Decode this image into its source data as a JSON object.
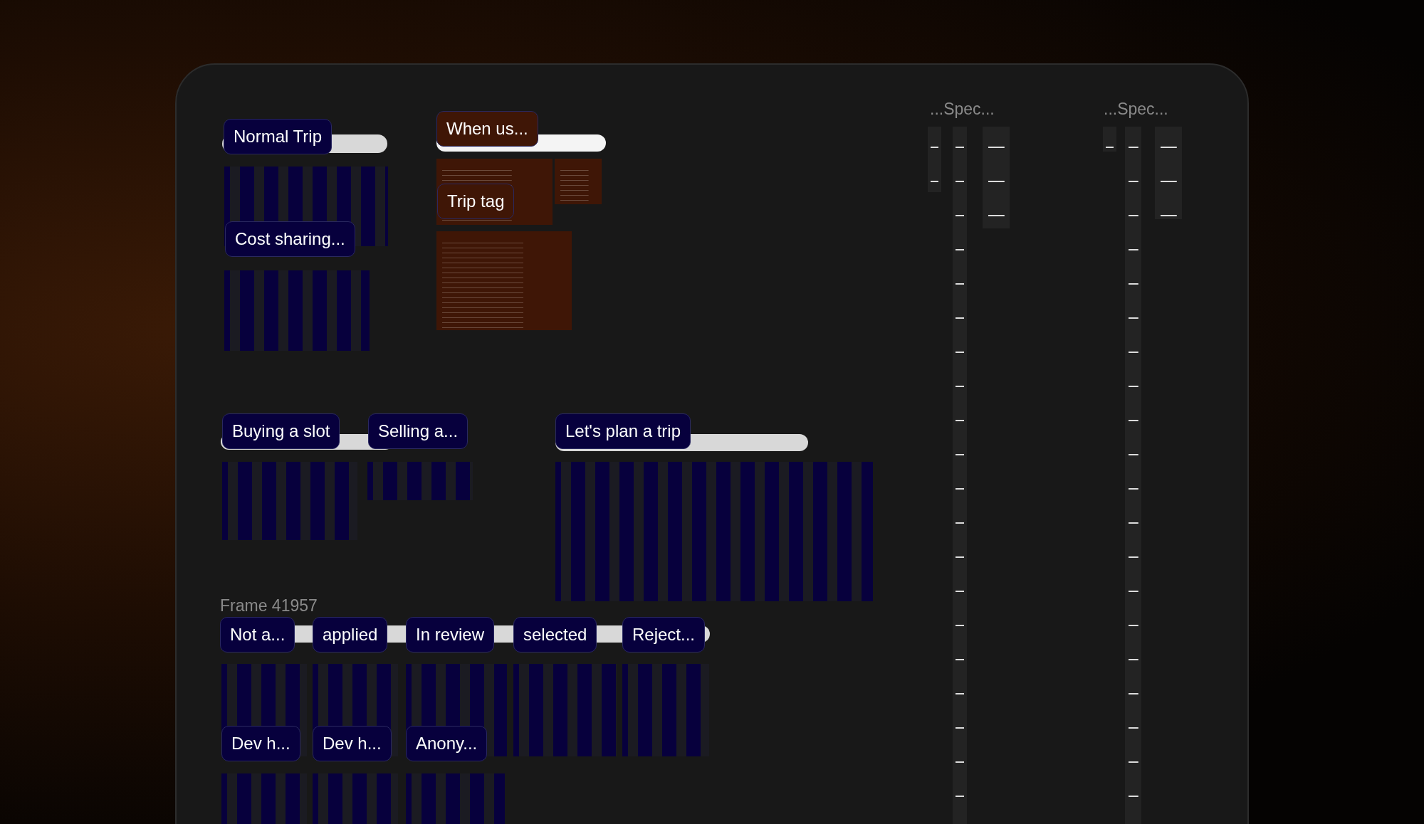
{
  "canvas": {
    "frame_titles": [
      {
        "text": "Frame 41957"
      },
      {
        "text": "...Spec..."
      },
      {
        "text": "...Spec..."
      }
    ],
    "labels": [
      {
        "text": "Normal Trip",
        "color": "#07003d"
      },
      {
        "text": "When us...",
        "color": "#3f1606"
      },
      {
        "text": "Trip tag",
        "color": "#3f1606"
      },
      {
        "text": "Cost sharing...",
        "color": "#07003d"
      },
      {
        "text": "Buying a slot",
        "color": "#07003d"
      },
      {
        "text": "Selling a...",
        "color": "#07003d"
      },
      {
        "text": "Let's plan a trip",
        "color": "#07003d"
      },
      {
        "text": "Not a...",
        "color": "#07003d"
      },
      {
        "text": "applied",
        "color": "#07003d"
      },
      {
        "text": "In review",
        "color": "#07003d"
      },
      {
        "text": "selected",
        "color": "#07003d"
      },
      {
        "text": "Reject...",
        "color": "#07003d"
      },
      {
        "text": "Dev h...",
        "color": "#07003d"
      },
      {
        "text": "Dev h...",
        "color": "#07003d"
      },
      {
        "text": "Anony...",
        "color": "#07003d"
      }
    ]
  }
}
